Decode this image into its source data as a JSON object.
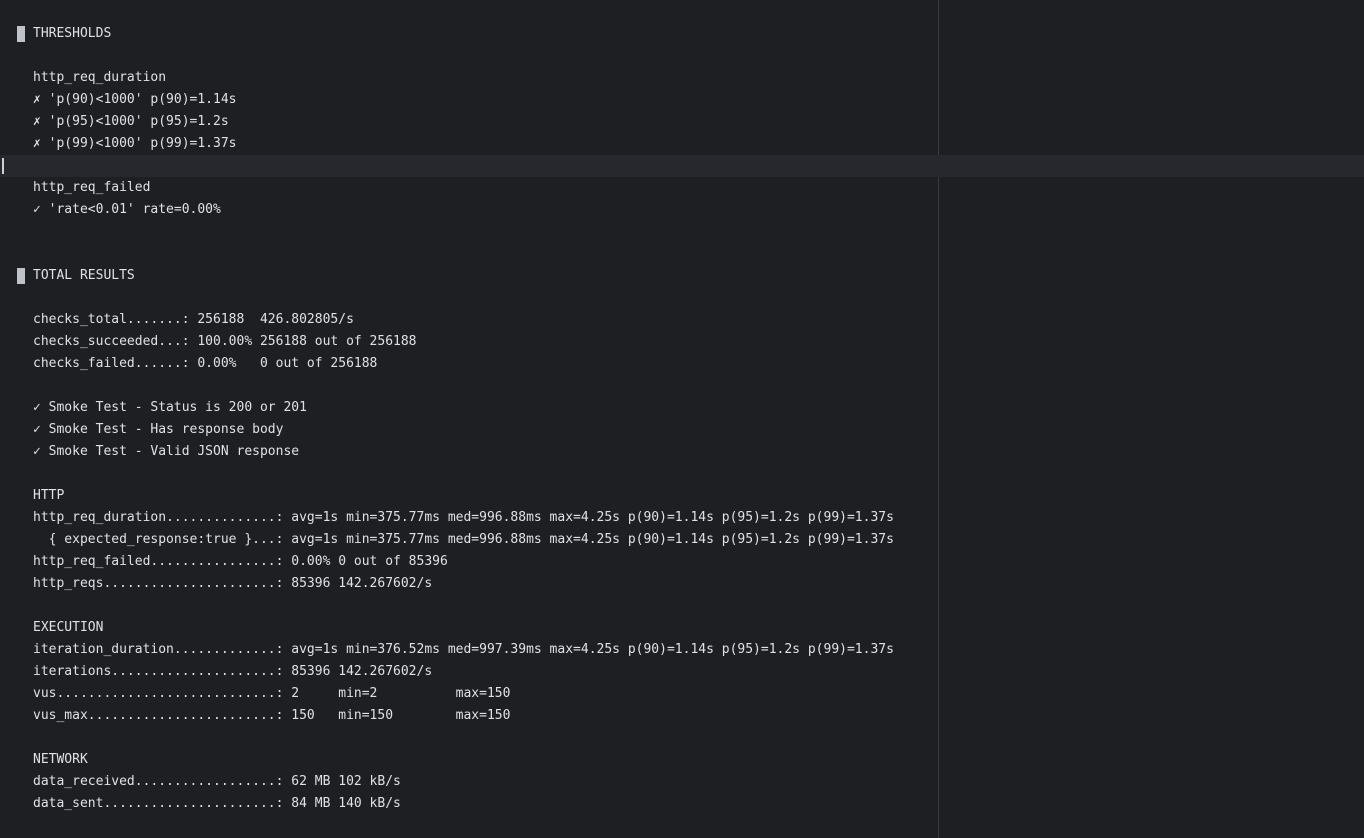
{
  "lines": [
    {
      "text": "THRESHOLDS",
      "section": true
    },
    {
      "text": ""
    },
    {
      "text": "http_req_duration"
    },
    {
      "text": "✗ 'p(90)<1000' p(90)=1.14s"
    },
    {
      "text": "✗ 'p(95)<1000' p(95)=1.2s"
    },
    {
      "text": "✗ 'p(99)<1000' p(99)=1.37s"
    },
    {
      "text": "",
      "current": true
    },
    {
      "text": "http_req_failed"
    },
    {
      "text": "✓ 'rate<0.01' rate=0.00%"
    },
    {
      "text": ""
    },
    {
      "text": ""
    },
    {
      "text": "TOTAL RESULTS",
      "section": true
    },
    {
      "text": ""
    },
    {
      "text": "checks_total.......: 256188  426.802805/s"
    },
    {
      "text": "checks_succeeded...: 100.00% 256188 out of 256188"
    },
    {
      "text": "checks_failed......: 0.00%   0 out of 256188"
    },
    {
      "text": ""
    },
    {
      "text": "✓ Smoke Test - Status is 200 or 201"
    },
    {
      "text": "✓ Smoke Test - Has response body"
    },
    {
      "text": "✓ Smoke Test - Valid JSON response"
    },
    {
      "text": ""
    },
    {
      "text": "HTTP"
    },
    {
      "text": "http_req_duration..............: avg=1s min=375.77ms med=996.88ms max=4.25s p(90)=1.14s p(95)=1.2s p(99)=1.37s"
    },
    {
      "text": "  { expected_response:true }...: avg=1s min=375.77ms med=996.88ms max=4.25s p(90)=1.14s p(95)=1.2s p(99)=1.37s"
    },
    {
      "text": "http_req_failed................: 0.00% 0 out of 85396"
    },
    {
      "text": "http_reqs......................: 85396 142.267602/s"
    },
    {
      "text": ""
    },
    {
      "text": "EXECUTION"
    },
    {
      "text": "iteration_duration.............: avg=1s min=376.52ms med=997.39ms max=4.25s p(90)=1.14s p(95)=1.2s p(99)=1.37s"
    },
    {
      "text": "iterations.....................: 85396 142.267602/s"
    },
    {
      "text": "vus............................: 2     min=2          max=150"
    },
    {
      "text": "vus_max........................: 150   min=150        max=150"
    },
    {
      "text": ""
    },
    {
      "text": "NETWORK"
    },
    {
      "text": "data_received..................: 62 MB 102 kB/s"
    },
    {
      "text": "data_sent......................: 84 MB 140 kB/s"
    }
  ]
}
